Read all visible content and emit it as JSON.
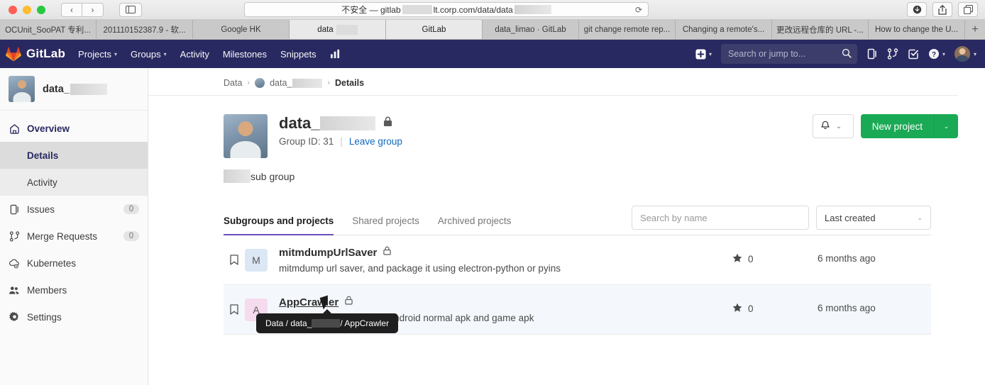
{
  "browser": {
    "url_prefix": "不安全 — gitlab",
    "url_suffix": "lt.corp.com/data/data",
    "reload_icon": "reload-icon",
    "back_icon": "‹",
    "forward_icon": "›",
    "tabs": [
      {
        "label": "OCUnit_SooPAT 专利...",
        "active": false
      },
      {
        "label": "201110152387.9 - 软...",
        "active": false
      },
      {
        "label": "Google HK",
        "active": false
      },
      {
        "label": "data",
        "active": true,
        "masked": true
      },
      {
        "label": "GitLab",
        "active": true
      },
      {
        "label": "data_limao · GitLab",
        "active": false
      },
      {
        "label": "git change remote rep...",
        "active": false
      },
      {
        "label": "Changing a remote's...",
        "active": false
      },
      {
        "label": "更改远程仓库的 URL -...",
        "active": false
      },
      {
        "label": "How to change the U...",
        "active": false
      }
    ],
    "new_tab_label": "+"
  },
  "navbar": {
    "brand": "GitLab",
    "items": [
      {
        "label": "Projects",
        "caret": true
      },
      {
        "label": "Groups",
        "caret": true
      },
      {
        "label": "Activity",
        "caret": false
      },
      {
        "label": "Milestones",
        "caret": false
      },
      {
        "label": "Snippets",
        "caret": false
      }
    ],
    "analytics_icon": "chart-icon",
    "plus_icon": "plus-icon",
    "search_placeholder": "Search or jump to...",
    "search_icon": "search-icon",
    "issues_icon": "issues-icon",
    "merge_requests_icon": "merge-request-icon",
    "todos_icon": "todos-icon",
    "help_icon": "help-icon",
    "avatar_icon": "user-avatar"
  },
  "sidebar": {
    "group_name": "data_",
    "items": [
      {
        "label": "Overview",
        "icon": "home-icon",
        "count": null
      },
      {
        "label": "Issues",
        "icon": "issues-icon",
        "count": "0"
      },
      {
        "label": "Merge Requests",
        "icon": "merge-request-icon",
        "count": "0"
      },
      {
        "label": "Kubernetes",
        "icon": "kubernetes-icon",
        "count": null
      },
      {
        "label": "Members",
        "icon": "members-icon",
        "count": null
      },
      {
        "label": "Settings",
        "icon": "gear-icon",
        "count": null
      }
    ],
    "sub_items": [
      {
        "label": "Details",
        "active": true
      },
      {
        "label": "Activity",
        "active": false
      }
    ]
  },
  "breadcrumb": {
    "root": "Data",
    "group": "data_",
    "current": "Details",
    "separator": "›"
  },
  "group": {
    "title": "data_",
    "visibility_icon": "lock-icon",
    "group_id_label": "Group ID: 31",
    "divider": "|",
    "leave_group": "Leave group",
    "description": "sub group",
    "bell_icon": "bell-icon",
    "bell_caret": "⌄",
    "new_project_label": "New project",
    "new_project_caret": "⌄",
    "new_project_color": "#1aaa55"
  },
  "content_tabs": [
    {
      "label": "Subgroups and projects",
      "active": true
    },
    {
      "label": "Shared projects",
      "active": false
    },
    {
      "label": "Archived projects",
      "active": false
    }
  ],
  "filters": {
    "search_placeholder": "Search by name",
    "sort_value": "Last created",
    "sort_caret": "⌄"
  },
  "projects": [
    {
      "initial": "M",
      "name": "mitmdumpUrlSaver",
      "visibility_icon": "lock-icon",
      "description": "mitmdump url saver, and package it using electron-python or pyins",
      "stars": "0",
      "star_icon": "star-icon",
      "bookmark_icon": "bookmark-icon",
      "updated": "6 months ago",
      "hover": false,
      "underlined": false
    },
    {
      "initial": "A",
      "name": "AppCrawler",
      "visibility_icon": "lock-icon",
      "description": "AppCrawler to auto crawl android normal apk and game apk",
      "stars": "0",
      "star_icon": "star-icon",
      "bookmark_icon": "bookmark-icon",
      "updated": "6 months ago",
      "hover": true,
      "underlined": true
    }
  ],
  "tooltip": {
    "prefix": "Data / data_",
    "suffix": " / AppCrawler"
  }
}
